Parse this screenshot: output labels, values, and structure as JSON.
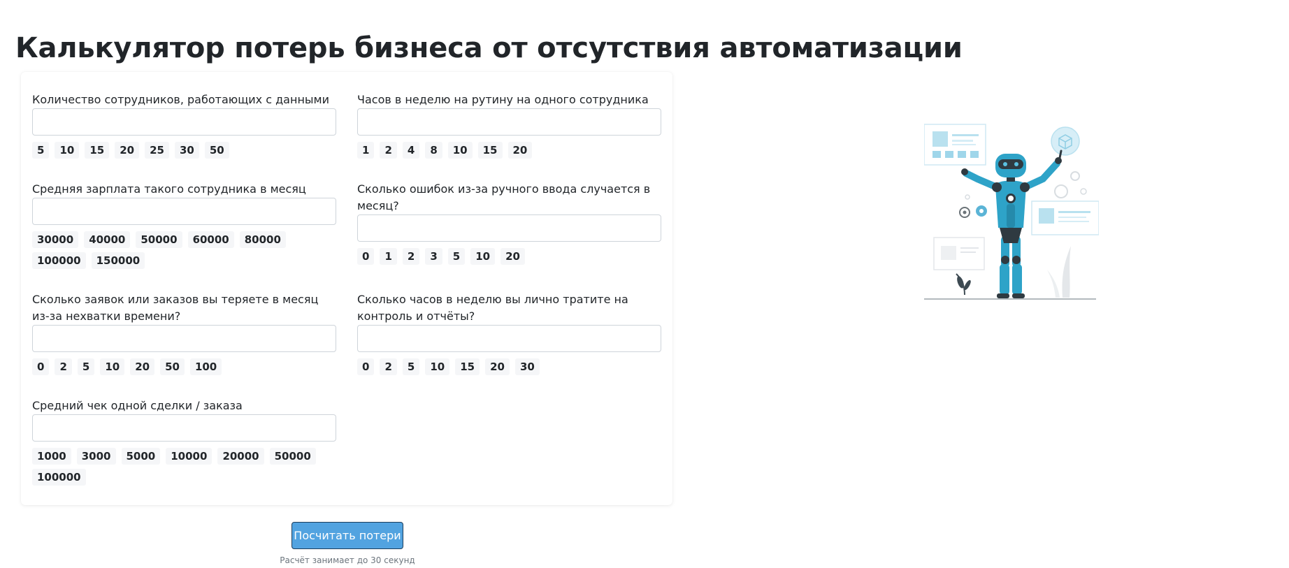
{
  "page": {
    "title": "Калькулятор потерь бизнеса от отсутствия автоматизации"
  },
  "fields": [
    {
      "label": "Количество сотрудников, работающих с данными",
      "value": "",
      "chips": [
        "5",
        "10",
        "15",
        "20",
        "25",
        "30",
        "50"
      ]
    },
    {
      "label": "Часов в неделю на рутину на одного сотрудника",
      "value": "",
      "chips": [
        "1",
        "2",
        "4",
        "8",
        "10",
        "15",
        "20"
      ]
    },
    {
      "label": "Средняя зарплата такого сотрудника в месяц",
      "value": "",
      "chips": [
        "30000",
        "40000",
        "50000",
        "60000",
        "80000",
        "100000",
        "150000"
      ]
    },
    {
      "label": "Сколько ошибок из-за ручного ввода случается в месяц?",
      "value": "",
      "chips": [
        "0",
        "1",
        "2",
        "3",
        "5",
        "10",
        "20"
      ]
    },
    {
      "label": "Сколько заявок или заказов вы теряете в месяц из-за нехватки времени?",
      "value": "",
      "chips": [
        "0",
        "2",
        "5",
        "10",
        "20",
        "50",
        "100"
      ]
    },
    {
      "label": "Сколько часов в неделю вы лично тратите на контроль и отчёты?",
      "value": "",
      "chips": [
        "0",
        "2",
        "5",
        "10",
        "15",
        "20",
        "30"
      ]
    },
    {
      "label": "Средний чек одной сделки / заказа",
      "value": "",
      "chips": [
        "1000",
        "3000",
        "5000",
        "10000",
        "20000",
        "50000",
        "100000"
      ]
    }
  ],
  "submit": {
    "label": "Посчитать потери",
    "hint": "Расчёт занимает до 30 секунд"
  },
  "colors": {
    "accent": "#52a3e0",
    "robot": "#2ea3c8",
    "chip_bg": "#f5f6f8"
  },
  "illustration": {
    "icon": "robot-illustration"
  }
}
